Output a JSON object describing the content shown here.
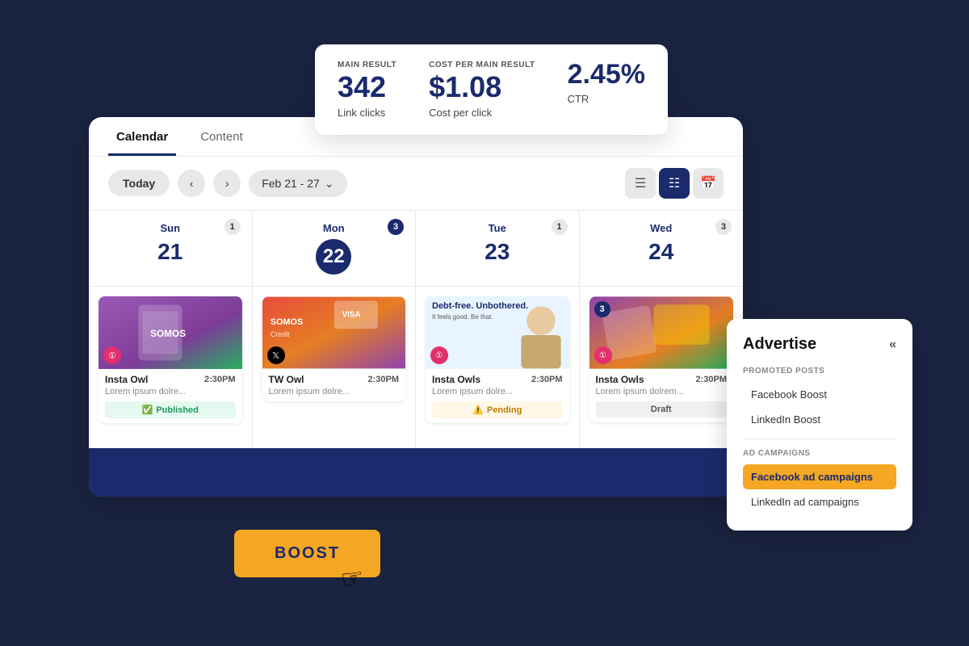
{
  "stats": {
    "main_result_label": "MAIN RESULT",
    "main_result_value": "342",
    "main_result_sub": "Link clicks",
    "cost_label": "COST PER MAIN RESULT",
    "cost_value": "$1.08",
    "cost_sub": "Cost per click",
    "ctr_value": "2.45%",
    "ctr_sub": "CTR"
  },
  "tabs": [
    {
      "label": "Calendar",
      "active": true
    },
    {
      "label": "Content",
      "active": false
    }
  ],
  "toolbar": {
    "today": "Today",
    "date_range": "Feb 21 - 27",
    "view_icons": [
      "list",
      "grid",
      "calendar"
    ]
  },
  "days": [
    {
      "name": "Sun",
      "number": "21",
      "badge": "1",
      "badge_dark": false,
      "circle": false
    },
    {
      "name": "Mon",
      "number": "22",
      "badge": "3",
      "badge_dark": true,
      "circle": true
    },
    {
      "name": "Tue",
      "number": "23",
      "badge": "1",
      "badge_dark": false,
      "circle": false
    },
    {
      "name": "Wed",
      "number": "24",
      "badge": "3",
      "badge_dark": false,
      "circle": false
    }
  ],
  "posts": [
    {
      "platform": "instagram",
      "platform_icon": "📷",
      "account": "Insta Owl",
      "time": "2:30PM",
      "description": "Lorem ipsum dolre...",
      "status": "Published",
      "status_type": "published",
      "thumb_class": "thumb-sun"
    },
    {
      "platform": "twitter",
      "platform_icon": "𝕏",
      "account": "TW Owl",
      "time": "2:30PM",
      "description": "Lorem ipsum dolre...",
      "status": "",
      "status_type": "none",
      "thumb_class": "thumb-mon"
    },
    {
      "platform": "instagram",
      "platform_icon": "📷",
      "account": "Insta Owls",
      "time": "2:30PM",
      "description": "Lorem ipsum dolre...",
      "status": "Pending",
      "status_type": "pending",
      "thumb_class": "thumb-tue",
      "badge": null,
      "headline": "Debt-free. Unbothered.",
      "subtext": "It feels good. Be that."
    },
    {
      "platform": "instagram",
      "platform_icon": "📷",
      "account": "Insta Owls",
      "time": "2:30PM",
      "description": "Lorem ipsum dolrem...",
      "status": "Draft",
      "status_type": "draft",
      "thumb_class": "thumb-wed",
      "badge": "3"
    }
  ],
  "advertise": {
    "title": "Advertise",
    "close_label": "«",
    "promoted_posts_label": "PROMOTED POSTS",
    "promoted_items": [
      "Facebook Boost",
      "LinkedIn Boost"
    ],
    "ad_campaigns_label": "AD CAMPAIGNS",
    "ad_items": [
      {
        "label": "Facebook ad campaigns",
        "active": true
      },
      {
        "label": "LinkedIn ad campaigns",
        "active": false
      }
    ]
  },
  "boost": {
    "label": "BOOST"
  }
}
